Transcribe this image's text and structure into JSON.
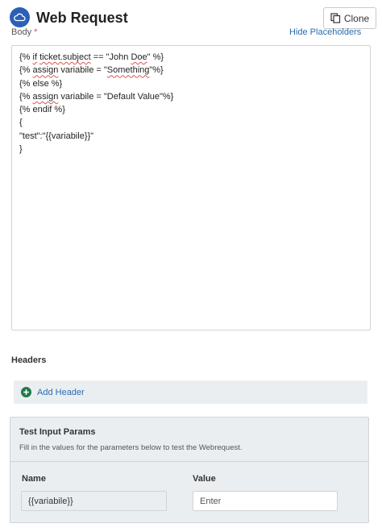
{
  "header": {
    "title": "Web Request",
    "clone_label": "Clone"
  },
  "body_section": {
    "label": "Body",
    "required_mark": "*",
    "hide_placeholders_label": "Hide Placeholders",
    "code_lines": [
      "{% if ticket.subject == \"John Doe\" %}",
      "{% assign variabile = \"Something\"%}",
      "{% else %}",
      "{% assign variabile = \"Default Value\"%}",
      "{% endif %}",
      "{",
      "\"test\":\"{{variabile}}\"",
      "}"
    ]
  },
  "headers_section": {
    "title": "Headers",
    "add_header_label": "Add Header"
  },
  "test_params": {
    "title": "Test Input Params",
    "subtitle": "Fill in the values for the parameters below to test the Webrequest.",
    "name_column": "Name",
    "value_column": "Value",
    "rows": [
      {
        "name": "{{variabile}}",
        "value": "",
        "placeholder": "Enter"
      }
    ]
  },
  "colors": {
    "brand": "#2c5fb5",
    "link": "#2b6cb0",
    "add_icon": "#1f7a4a",
    "panel_bg": "#ebeef0",
    "required": "#d9534f"
  },
  "icons": {
    "logo": "cloud-logo-icon",
    "clone": "copy-icon",
    "add": "plus-circle-icon"
  }
}
